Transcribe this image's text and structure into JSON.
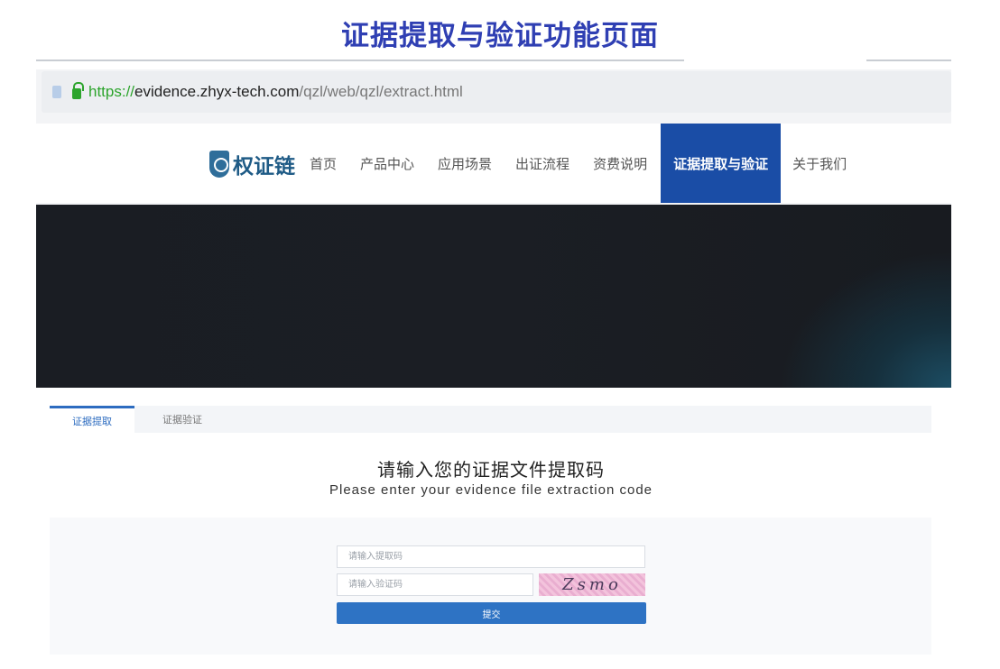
{
  "page_title": "证据提取与验证功能页面",
  "browser": {
    "url_scheme": "https://",
    "url_host": "evidence.zhyx-tech.com",
    "url_path": "/qzl/web/qzl/extract.html"
  },
  "site": {
    "logo_text": "权证链",
    "nav": [
      {
        "label": "首页"
      },
      {
        "label": "产品中心"
      },
      {
        "label": "应用场景"
      },
      {
        "label": "出证流程"
      },
      {
        "label": "资费说明"
      },
      {
        "label": "证据提取与验证"
      },
      {
        "label": "关于我们"
      }
    ]
  },
  "tabs": [
    {
      "label": "证据提取"
    },
    {
      "label": "证据验证"
    }
  ],
  "form": {
    "heading_cn": "请输入您的证据文件提取码",
    "heading_en": "Please enter your evidence file extraction code",
    "code_placeholder": "请输入提取码",
    "captcha_placeholder": "请输入验证码",
    "captcha_text": "Zsmo",
    "submit_label": "提交"
  },
  "colors": {
    "title": "#2f3fb3",
    "nav_active": "#1a4da6",
    "submit": "#2e73c4",
    "secure_scheme": "#2ca42c"
  }
}
